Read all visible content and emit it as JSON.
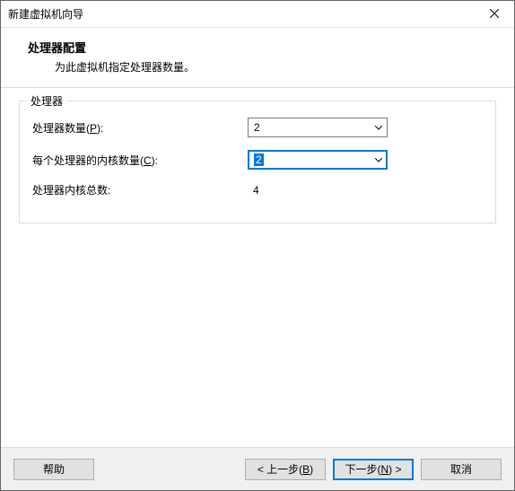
{
  "window": {
    "title": "新建虚拟机向导"
  },
  "header": {
    "title": "处理器配置",
    "desc": "为此虚拟机指定处理器数量。"
  },
  "group": {
    "legend": "处理器",
    "rows": {
      "processors": {
        "label_pre": "处理器数量(",
        "hotkey": "P",
        "label_post": "):",
        "value": "2"
      },
      "cores": {
        "label_pre": "每个处理器的内核数量(",
        "hotkey": "C",
        "label_post": "):",
        "value": "2"
      },
      "total": {
        "label": "处理器内核总数:",
        "value": "4"
      }
    }
  },
  "footer": {
    "help": "帮助",
    "back_pre": "< 上一步(",
    "back_hot": "B",
    "back_post": ")",
    "next_pre": "下一步(",
    "next_hot": "N",
    "next_post": ") >",
    "cancel": "取消"
  }
}
